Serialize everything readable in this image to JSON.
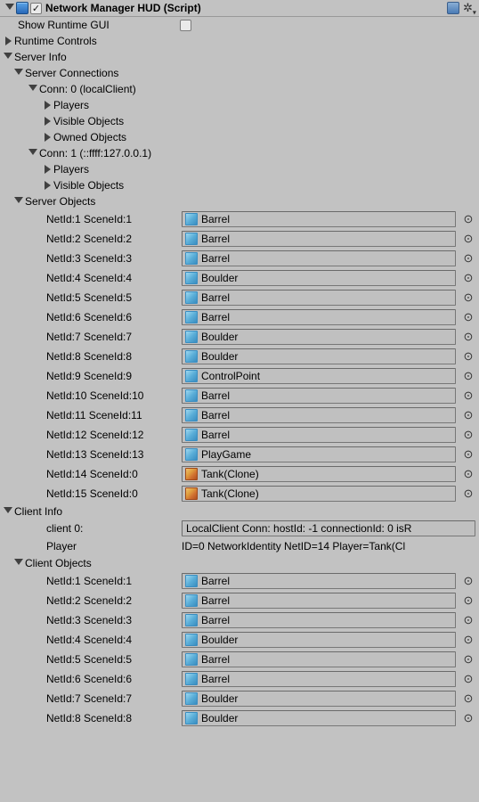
{
  "header": {
    "title": "Network Manager HUD (Script)"
  },
  "showRuntimeGUI": {
    "label": "Show Runtime GUI",
    "checked": false
  },
  "runtimeControls": {
    "label": "Runtime Controls"
  },
  "serverInfo": {
    "label": "Server Info",
    "connectionsLabel": "Server Connections",
    "connections": [
      {
        "label": "Conn: 0 (localClient)",
        "children": [
          {
            "label": "Players"
          },
          {
            "label": "Visible Objects"
          },
          {
            "label": "Owned Objects"
          }
        ]
      },
      {
        "label": "Conn: 1 (::ffff:127.0.0.1)",
        "children": [
          {
            "label": "Players"
          },
          {
            "label": "Visible Objects"
          }
        ]
      }
    ],
    "objectsLabel": "Server Objects",
    "objects": [
      {
        "label": "NetId:1 SceneId:1",
        "name": "Barrel",
        "iconType": "cube"
      },
      {
        "label": "NetId:2 SceneId:2",
        "name": "Barrel",
        "iconType": "cube"
      },
      {
        "label": "NetId:3 SceneId:3",
        "name": "Barrel",
        "iconType": "cube"
      },
      {
        "label": "NetId:4 SceneId:4",
        "name": "Boulder",
        "iconType": "cube"
      },
      {
        "label": "NetId:5 SceneId:5",
        "name": "Barrel",
        "iconType": "cube"
      },
      {
        "label": "NetId:6 SceneId:6",
        "name": "Barrel",
        "iconType": "cube"
      },
      {
        "label": "NetId:7 SceneId:7",
        "name": "Boulder",
        "iconType": "cube"
      },
      {
        "label": "NetId:8 SceneId:8",
        "name": "Boulder",
        "iconType": "cube"
      },
      {
        "label": "NetId:9 SceneId:9",
        "name": "ControlPoint",
        "iconType": "cube"
      },
      {
        "label": "NetId:10 SceneId:10",
        "name": "Barrel",
        "iconType": "cube"
      },
      {
        "label": "NetId:11 SceneId:11",
        "name": "Barrel",
        "iconType": "cube"
      },
      {
        "label": "NetId:12 SceneId:12",
        "name": "Barrel",
        "iconType": "cube"
      },
      {
        "label": "NetId:13 SceneId:13",
        "name": "PlayGame",
        "iconType": "cube"
      },
      {
        "label": "NetId:14 SceneId:0",
        "name": "Tank(Clone)",
        "iconType": "prefab"
      },
      {
        "label": "NetId:15 SceneId:0",
        "name": "Tank(Clone)",
        "iconType": "prefab"
      }
    ]
  },
  "clientInfo": {
    "label": "Client Info",
    "client0Label": "client 0:",
    "client0Value": "LocalClient Conn: hostId: -1 connectionId: 0 isR",
    "playerLabel": "Player",
    "playerValue": "ID=0 NetworkIdentity NetID=14 Player=Tank(Cl",
    "objectsLabel": "Client Objects",
    "objects": [
      {
        "label": "NetId:1 SceneId:1",
        "name": "Barrel",
        "iconType": "cube"
      },
      {
        "label": "NetId:2 SceneId:2",
        "name": "Barrel",
        "iconType": "cube"
      },
      {
        "label": "NetId:3 SceneId:3",
        "name": "Barrel",
        "iconType": "cube"
      },
      {
        "label": "NetId:4 SceneId:4",
        "name": "Boulder",
        "iconType": "cube"
      },
      {
        "label": "NetId:5 SceneId:5",
        "name": "Barrel",
        "iconType": "cube"
      },
      {
        "label": "NetId:6 SceneId:6",
        "name": "Barrel",
        "iconType": "cube"
      },
      {
        "label": "NetId:7 SceneId:7",
        "name": "Boulder",
        "iconType": "cube"
      },
      {
        "label": "NetId:8 SceneId:8",
        "name": "Boulder",
        "iconType": "cube"
      }
    ]
  }
}
